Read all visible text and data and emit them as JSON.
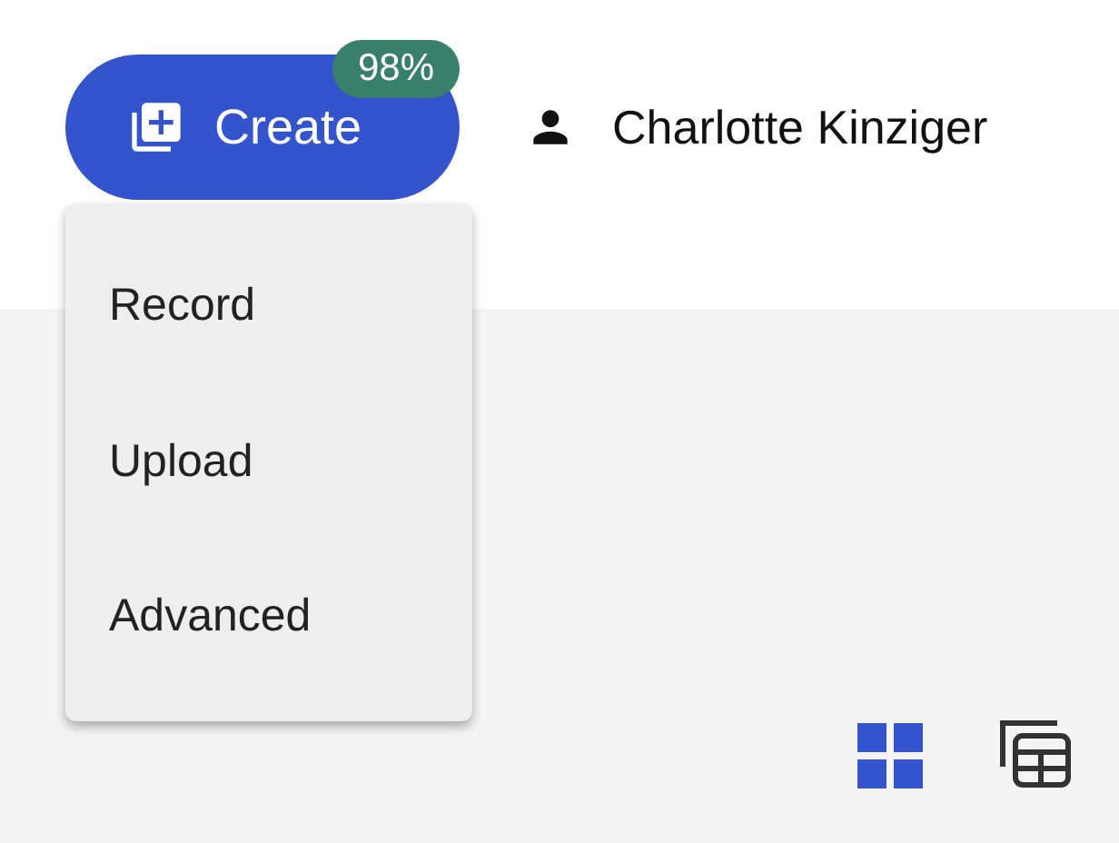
{
  "create_button": {
    "label": "Create",
    "badge": "98%"
  },
  "user": {
    "name": "Charlotte Kinziger"
  },
  "create_menu": {
    "items": [
      {
        "label": "Record"
      },
      {
        "label": "Upload"
      },
      {
        "label": "Advanced"
      }
    ]
  },
  "view_toggles": [
    {
      "kind": "grid",
      "selected": true
    },
    {
      "kind": "table",
      "selected": false
    }
  ]
}
